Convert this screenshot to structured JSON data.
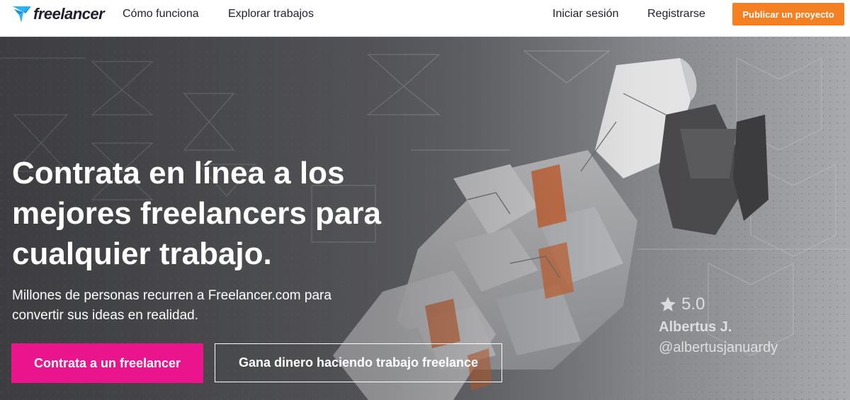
{
  "colors": {
    "accent": "#f48023",
    "hire_button": "#ea158c",
    "logo_blue": "#29b2fe",
    "text_dark": "#1f1f2e"
  },
  "header": {
    "logo_text": "freelancer",
    "logo_icon": "freelancer-bird-icon",
    "nav": {
      "how_it_works": "Cómo funciona",
      "browse_jobs": "Explorar trabajos"
    },
    "login": "Iniciar sesión",
    "signup": "Registrarse",
    "post_project": "Publicar un proyecto"
  },
  "hero": {
    "headline": "Contrata en línea a los mejores freelancers para cualquier trabajo.",
    "subtext": "Millones de personas recurren a Freelancer.com para convertir sus ideas en realidad.",
    "hire_button": "Contrata a un freelancer",
    "earn_button": "Gana dinero haciendo trabajo freelance",
    "credit": {
      "rating_icon": "star-icon",
      "rating": "5.0",
      "name": "Albertus J.",
      "handle": "@albertusjanuardy"
    }
  }
}
